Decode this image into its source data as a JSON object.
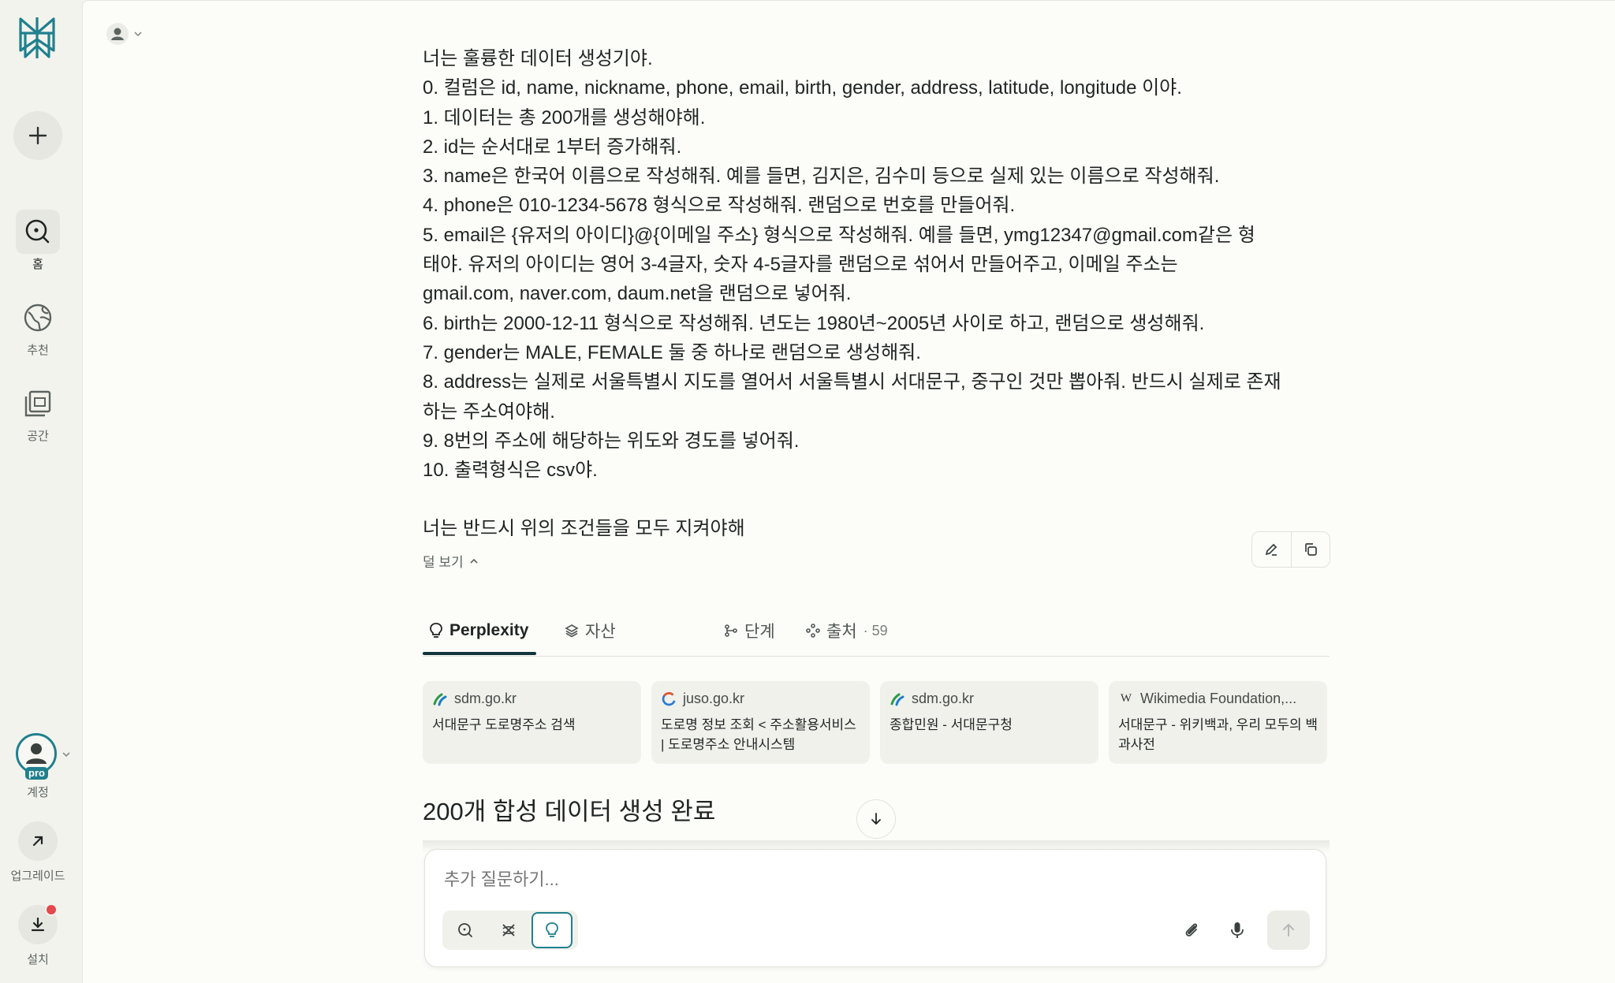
{
  "sidebar": {
    "nav": [
      {
        "id": "home",
        "label": "홈",
        "icon": "search-icon"
      },
      {
        "id": "discover",
        "label": "추천",
        "icon": "globe-icon"
      },
      {
        "id": "spaces",
        "label": "공간",
        "icon": "spaces-icon"
      }
    ],
    "account_label": "계정",
    "pro_badge": "pro",
    "upgrade_label": "업그레이드",
    "install_label": "설치"
  },
  "prompt": {
    "lines": [
      "너는 훌륭한 데이터 생성기야.",
      "0. 컬럼은 id, name, nickname, phone, email, birth, gender, address, latitude, longitude 이야.",
      "1. 데이터는 총 200개를 생성해야해.",
      "2. id는 순서대로 1부터 증가해줘.",
      "3. name은 한국어 이름으로 작성해줘. 예를 들면, 김지은, 김수미 등으로 실제 있는 이름으로 작성해줘.",
      "4. phone은 010-1234-5678 형식으로 작성해줘. 랜덤으로 번호를 만들어줘.",
      "5. email은 {유저의 아이디}@{이메일 주소} 형식으로 작성해줘. 예를 들면, ymg12347@gmail.com같은 형",
      "태야. 유저의 아이디는 영어 3-4글자, 숫자 4-5글자를 랜덤으로 섞어서 만들어주고, 이메일 주소는",
      "gmail.com, naver.com, daum.net을 랜덤으로 넣어줘.",
      "6. birth는 2000-12-11 형식으로 작성해줘. 년도는 1980년~2005년 사이로 하고, 랜덤으로 생성해줘.",
      "7. gender는 MALE, FEMALE 둘 중 하나로 랜덤으로 생성해줘.",
      "8. address는 실제로 서울특별시 지도를 열어서 서울특별시 서대문구, 중구인 것만 뽑아줘. 반드시 실제로 존재",
      "하는 주소여야해.",
      "9. 8번의 주소에 해당하는 위도와 경도를 넣어줘.",
      "10. 출력형식은 csv야."
    ],
    "closing": "너는 반드시 위의 조건들을 모두 지켜야해",
    "less_label": "덜 보기"
  },
  "tabs": {
    "perplexity": "Perplexity",
    "assets": "자산",
    "steps": "단계",
    "sources": "출처",
    "sources_count": "· 59"
  },
  "sources": [
    {
      "domain": "sdm.go.kr",
      "title": "서대문구 도로명주소 검색",
      "favicon": "sdm-favicon"
    },
    {
      "domain": "juso.go.kr",
      "title": "도로명 정보 조회 < 주소활용서비스 | 도로명주소 안내시스템",
      "favicon": "juso-favicon"
    },
    {
      "domain": "sdm.go.kr",
      "title": "종합민원 - 서대문구청",
      "favicon": "sdm-favicon"
    },
    {
      "domain": "Wikimedia Foundation,...",
      "title": "서대문구 - 위키백과, 우리 모두의 백과사전",
      "favicon": "wikipedia-favicon"
    }
  ],
  "answer": {
    "heading": "200개 합성 데이터 생성 완료"
  },
  "ask": {
    "placeholder": "추가 질문하기..."
  },
  "colors": {
    "accent": "#20808d",
    "dark": "#13343b",
    "notification": "#e5484d"
  }
}
